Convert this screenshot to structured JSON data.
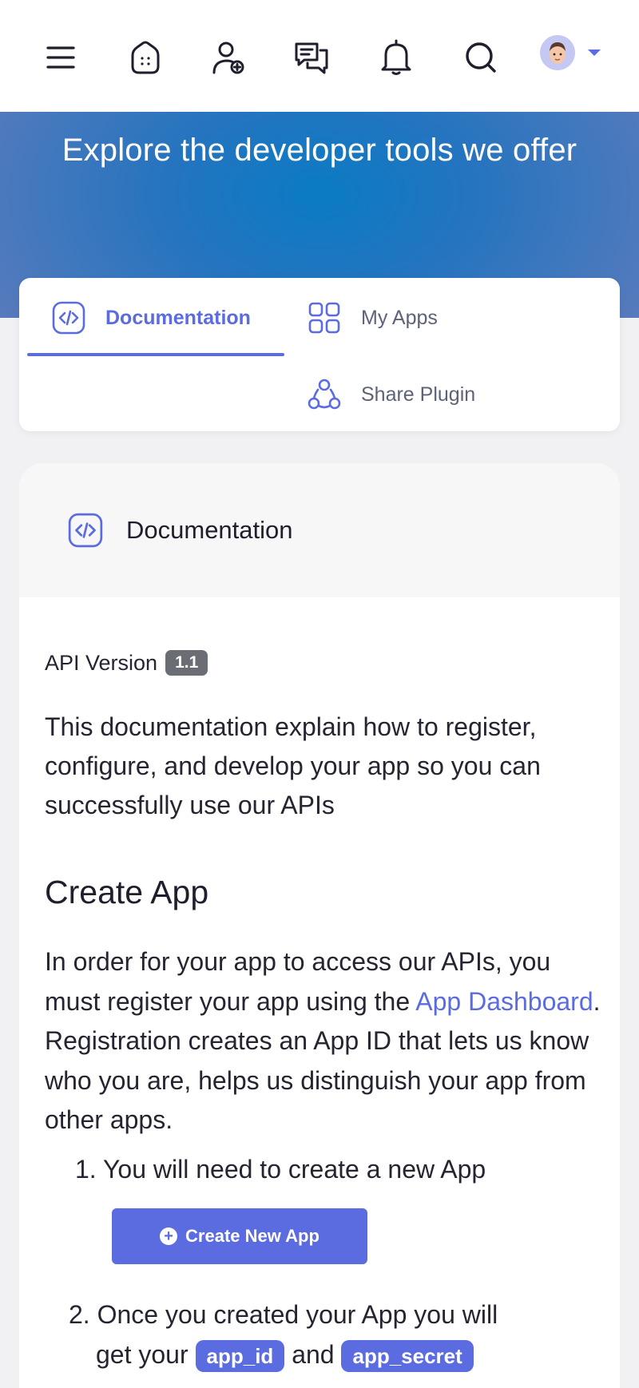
{
  "nav": {
    "icons": [
      "menu-icon",
      "home-icon",
      "add-user-icon",
      "messages-icon",
      "bell-icon",
      "search-icon"
    ],
    "avatar": "user-avatar",
    "accent": "#5b6be0"
  },
  "hero": {
    "title": "Explore the developer tools we offer"
  },
  "tabs": [
    {
      "label": "Documentation",
      "icon": "code-icon",
      "active": true
    },
    {
      "label": "My Apps",
      "icon": "grid-icon",
      "active": false
    },
    {
      "label": "Share Plugin",
      "icon": "share-icon",
      "active": false
    }
  ],
  "card": {
    "title": "Documentation",
    "api_label": "API Version",
    "api_version": "1.1",
    "intro": "This documentation explain how to register, configure, and develop your app so you can successfully use our APIs",
    "create_heading": "Create App",
    "para_before": "In order for your app to access our APIs, you must register your app using the ",
    "para_link": "App Dashboard",
    "para_after": ". Registration creates an App ID that lets us know who you are, helps us distinguish your app from other apps.",
    "step1_num": "1.",
    "step1_text": "You will need to create a new App",
    "create_button": "Create New App",
    "step2_num": "2.",
    "step2_line1": "Once you created your App you will",
    "step2_prefix": "get your",
    "step2_id": "app_id",
    "step2_and": "and",
    "step2_secret": "app_secret"
  }
}
